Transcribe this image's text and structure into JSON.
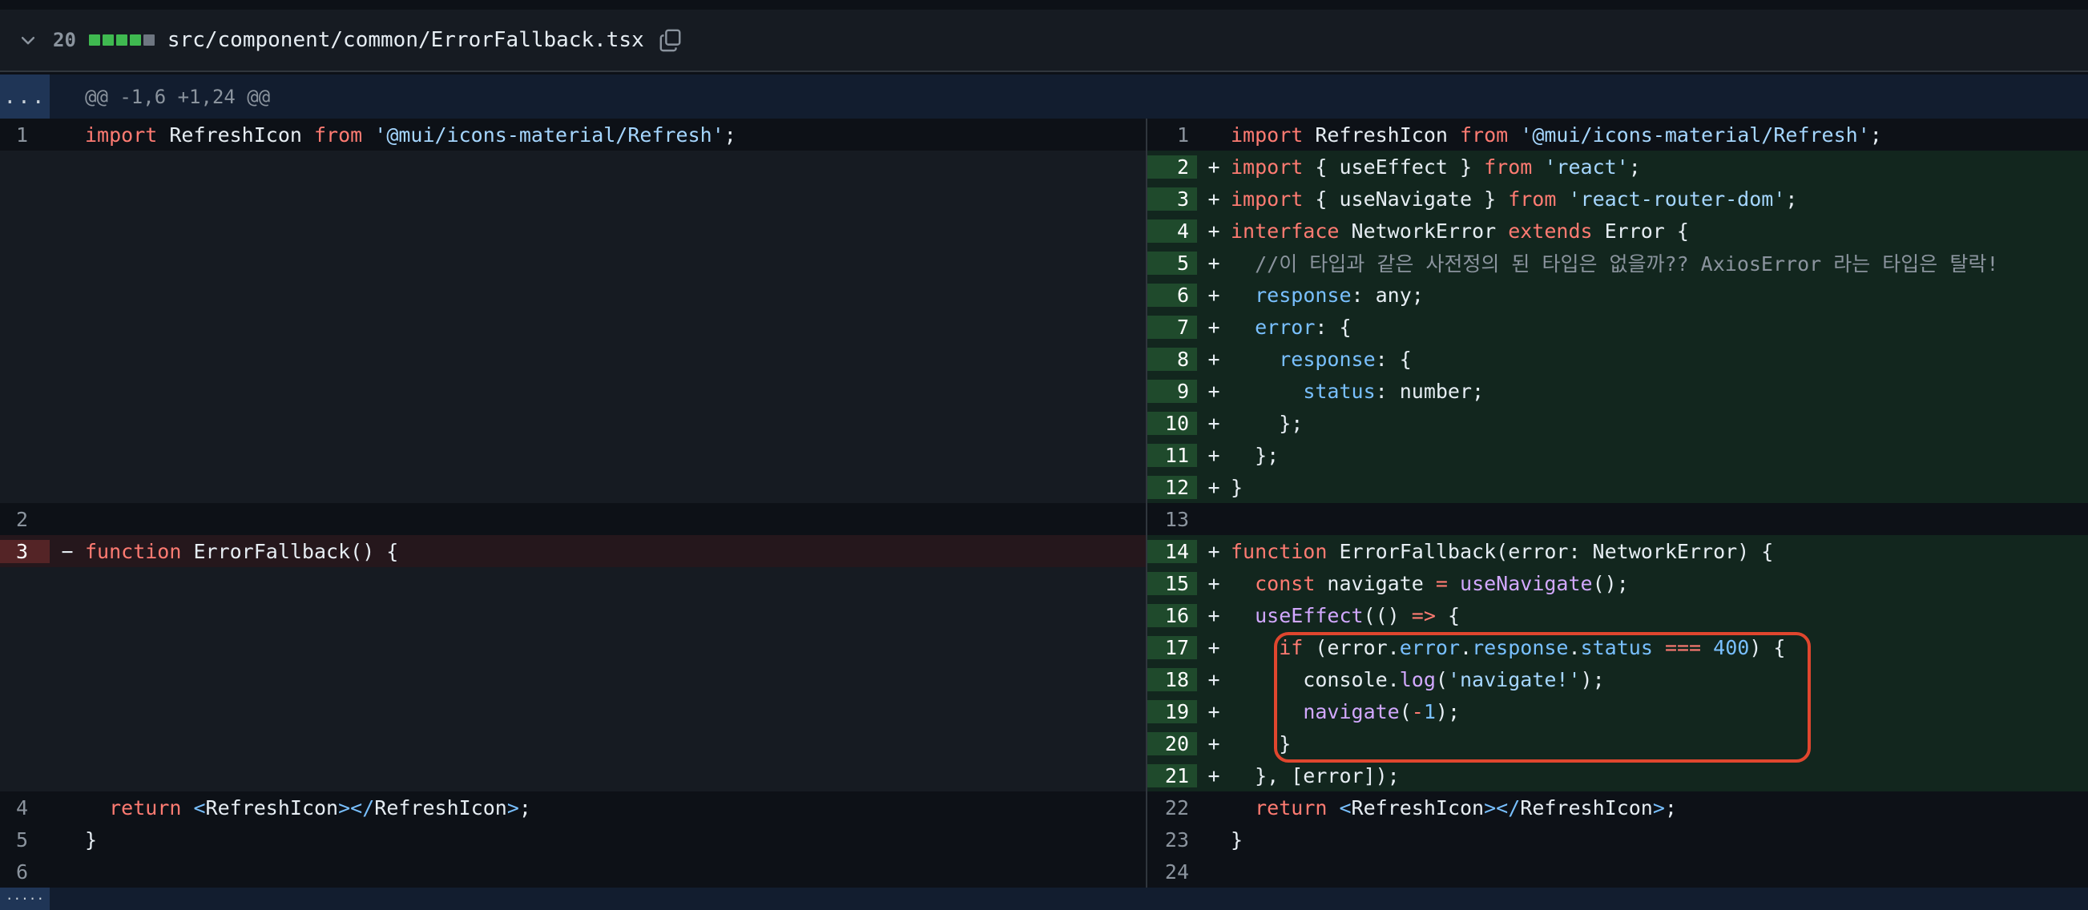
{
  "file": {
    "changes_count": "20",
    "path": "src/component/common/ErrorFallback.tsx",
    "diffstat": [
      "add",
      "add",
      "add",
      "add",
      "neutral"
    ],
    "colors": {
      "add": "#3fb950",
      "neutral": "#6e7681"
    }
  },
  "hunk": {
    "expand_label": "...",
    "header": "@@ -1,6 +1,24 @@"
  },
  "left_rows": [
    {
      "type": "normal",
      "num": "1",
      "marker": "",
      "tokens": [
        [
          "kw",
          "import"
        ],
        [
          "pl",
          " RefreshIcon "
        ],
        [
          "kw",
          "from"
        ],
        [
          "pl",
          " "
        ],
        [
          "str",
          "'@mui/icons-material/Refresh'"
        ],
        [
          "pl",
          ";"
        ]
      ]
    },
    {
      "type": "empty",
      "num": "",
      "marker": "",
      "tokens": []
    },
    {
      "type": "empty",
      "num": "",
      "marker": "",
      "tokens": []
    },
    {
      "type": "empty",
      "num": "",
      "marker": "",
      "tokens": []
    },
    {
      "type": "empty",
      "num": "",
      "marker": "",
      "tokens": []
    },
    {
      "type": "empty",
      "num": "",
      "marker": "",
      "tokens": []
    },
    {
      "type": "empty",
      "num": "",
      "marker": "",
      "tokens": []
    },
    {
      "type": "empty",
      "num": "",
      "marker": "",
      "tokens": []
    },
    {
      "type": "empty",
      "num": "",
      "marker": "",
      "tokens": []
    },
    {
      "type": "empty",
      "num": "",
      "marker": "",
      "tokens": []
    },
    {
      "type": "empty",
      "num": "",
      "marker": "",
      "tokens": []
    },
    {
      "type": "empty",
      "num": "",
      "marker": "",
      "tokens": []
    },
    {
      "type": "normal",
      "num": "2",
      "marker": "",
      "tokens": []
    },
    {
      "type": "del",
      "num": "3",
      "marker": "−",
      "tokens": [
        [
          "kw",
          "function"
        ],
        [
          "pl",
          " ErrorFallback() {"
        ]
      ]
    },
    {
      "type": "empty",
      "num": "",
      "marker": "",
      "tokens": []
    },
    {
      "type": "empty",
      "num": "",
      "marker": "",
      "tokens": []
    },
    {
      "type": "empty",
      "num": "",
      "marker": "",
      "tokens": []
    },
    {
      "type": "empty",
      "num": "",
      "marker": "",
      "tokens": []
    },
    {
      "type": "empty",
      "num": "",
      "marker": "",
      "tokens": []
    },
    {
      "type": "empty",
      "num": "",
      "marker": "",
      "tokens": []
    },
    {
      "type": "empty",
      "num": "",
      "marker": "",
      "tokens": []
    },
    {
      "type": "normal",
      "num": "4",
      "marker": "",
      "tokens": [
        [
          "pl",
          "  "
        ],
        [
          "kw",
          "return"
        ],
        [
          "pl",
          " "
        ],
        [
          "prop",
          "<"
        ],
        [
          "pl",
          "RefreshIcon"
        ],
        [
          "prop",
          "></"
        ],
        [
          "pl",
          "RefreshIcon"
        ],
        [
          "prop",
          ">"
        ],
        [
          "pl",
          ";"
        ]
      ]
    },
    {
      "type": "normal",
      "num": "5",
      "marker": "",
      "tokens": [
        [
          "pl",
          "}"
        ]
      ]
    },
    {
      "type": "normal",
      "num": "6",
      "marker": "",
      "tokens": []
    }
  ],
  "right_rows": [
    {
      "type": "normal",
      "num": "1",
      "marker": "",
      "tokens": [
        [
          "kw",
          "import"
        ],
        [
          "pl",
          " RefreshIcon "
        ],
        [
          "kw",
          "from"
        ],
        [
          "pl",
          " "
        ],
        [
          "str",
          "'@mui/icons-material/Refresh'"
        ],
        [
          "pl",
          ";"
        ]
      ]
    },
    {
      "type": "add",
      "num": "2",
      "marker": "+",
      "tokens": [
        [
          "kw",
          "import"
        ],
        [
          "pl",
          " { useEffect } "
        ],
        [
          "kw",
          "from"
        ],
        [
          "pl",
          " "
        ],
        [
          "str",
          "'react'"
        ],
        [
          "pl",
          ";"
        ]
      ]
    },
    {
      "type": "add",
      "num": "3",
      "marker": "+",
      "tokens": [
        [
          "kw",
          "import"
        ],
        [
          "pl",
          " { useNavigate } "
        ],
        [
          "kw",
          "from"
        ],
        [
          "pl",
          " "
        ],
        [
          "str",
          "'react-router-dom'"
        ],
        [
          "pl",
          ";"
        ]
      ]
    },
    {
      "type": "add",
      "num": "4",
      "marker": "+",
      "tokens": [
        [
          "kw",
          "interface"
        ],
        [
          "pl",
          " NetworkError "
        ],
        [
          "kw",
          "extends"
        ],
        [
          "pl",
          " Error {"
        ]
      ]
    },
    {
      "type": "add",
      "num": "5",
      "marker": "+",
      "tokens": [
        [
          "pl",
          "  "
        ],
        [
          "com",
          "//이 타입과 같은 사전정의 된 타입은 없을까?? AxiosError 라는 타입은 탈락!"
        ]
      ]
    },
    {
      "type": "add",
      "num": "6",
      "marker": "+",
      "tokens": [
        [
          "pl",
          "  "
        ],
        [
          "prop",
          "response"
        ],
        [
          "pl",
          ": any;"
        ]
      ]
    },
    {
      "type": "add",
      "num": "7",
      "marker": "+",
      "tokens": [
        [
          "pl",
          "  "
        ],
        [
          "prop",
          "error"
        ],
        [
          "pl",
          ": {"
        ]
      ]
    },
    {
      "type": "add",
      "num": "8",
      "marker": "+",
      "tokens": [
        [
          "pl",
          "    "
        ],
        [
          "prop",
          "response"
        ],
        [
          "pl",
          ": {"
        ]
      ]
    },
    {
      "type": "add",
      "num": "9",
      "marker": "+",
      "tokens": [
        [
          "pl",
          "      "
        ],
        [
          "prop",
          "status"
        ],
        [
          "pl",
          ": number;"
        ]
      ]
    },
    {
      "type": "add",
      "num": "10",
      "marker": "+",
      "tokens": [
        [
          "pl",
          "    };"
        ]
      ]
    },
    {
      "type": "add",
      "num": "11",
      "marker": "+",
      "tokens": [
        [
          "pl",
          "  };"
        ]
      ]
    },
    {
      "type": "add",
      "num": "12",
      "marker": "+",
      "tokens": [
        [
          "pl",
          "}"
        ]
      ]
    },
    {
      "type": "normal",
      "num": "13",
      "marker": "",
      "tokens": []
    },
    {
      "type": "add",
      "num": "14",
      "marker": "+",
      "tokens": [
        [
          "kw",
          "function"
        ],
        [
          "pl",
          " ErrorFallback(error: NetworkError) {"
        ]
      ]
    },
    {
      "type": "add",
      "num": "15",
      "marker": "+",
      "tokens": [
        [
          "pl",
          "  "
        ],
        [
          "kw",
          "const"
        ],
        [
          "pl",
          " navigate "
        ],
        [
          "kw",
          "="
        ],
        [
          "pl",
          " "
        ],
        [
          "fn",
          "useNavigate"
        ],
        [
          "pl",
          "();"
        ]
      ]
    },
    {
      "type": "add",
      "num": "16",
      "marker": "+",
      "tokens": [
        [
          "pl",
          "  "
        ],
        [
          "fn",
          "useEffect"
        ],
        [
          "pl",
          "(() "
        ],
        [
          "kw",
          "=>"
        ],
        [
          "pl",
          " {"
        ]
      ]
    },
    {
      "type": "add",
      "num": "17",
      "marker": "+",
      "tokens": [
        [
          "pl",
          "    "
        ],
        [
          "kw",
          "if"
        ],
        [
          "pl",
          " (error."
        ],
        [
          "prop",
          "error"
        ],
        [
          "pl",
          "."
        ],
        [
          "prop",
          "response"
        ],
        [
          "pl",
          "."
        ],
        [
          "prop",
          "status"
        ],
        [
          "pl",
          " "
        ],
        [
          "kw",
          "==="
        ],
        [
          "pl",
          " "
        ],
        [
          "num",
          "400"
        ],
        [
          "pl",
          ") {"
        ]
      ]
    },
    {
      "type": "add",
      "num": "18",
      "marker": "+",
      "tokens": [
        [
          "pl",
          "      console."
        ],
        [
          "fn",
          "log"
        ],
        [
          "pl",
          "("
        ],
        [
          "str",
          "'navigate!'"
        ],
        [
          "pl",
          ");"
        ]
      ]
    },
    {
      "type": "add",
      "num": "19",
      "marker": "+",
      "tokens": [
        [
          "pl",
          "      "
        ],
        [
          "fn",
          "navigate"
        ],
        [
          "pl",
          "("
        ],
        [
          "kw",
          "-"
        ],
        [
          "num",
          "1"
        ],
        [
          "pl",
          ");"
        ]
      ]
    },
    {
      "type": "add",
      "num": "20",
      "marker": "+",
      "tokens": [
        [
          "pl",
          "    }"
        ]
      ]
    },
    {
      "type": "add",
      "num": "21",
      "marker": "+",
      "tokens": [
        [
          "pl",
          "  }, [error]);"
        ]
      ]
    },
    {
      "type": "normal",
      "num": "22",
      "marker": "",
      "tokens": [
        [
          "pl",
          "  "
        ],
        [
          "kw",
          "return"
        ],
        [
          "pl",
          " "
        ],
        [
          "prop",
          "<"
        ],
        [
          "pl",
          "RefreshIcon"
        ],
        [
          "prop",
          "></"
        ],
        [
          "pl",
          "RefreshIcon"
        ],
        [
          "prop",
          ">"
        ],
        [
          "pl",
          ";"
        ]
      ]
    },
    {
      "type": "normal",
      "num": "23",
      "marker": "",
      "tokens": [
        [
          "pl",
          "}"
        ]
      ]
    },
    {
      "type": "normal",
      "num": "24",
      "marker": "",
      "tokens": []
    }
  ],
  "bottom": {
    "expand_label": "....."
  },
  "icons": {
    "collapse": "chevron-down-icon",
    "copy": "copy-icon"
  },
  "annotation_color": "#e0462e"
}
